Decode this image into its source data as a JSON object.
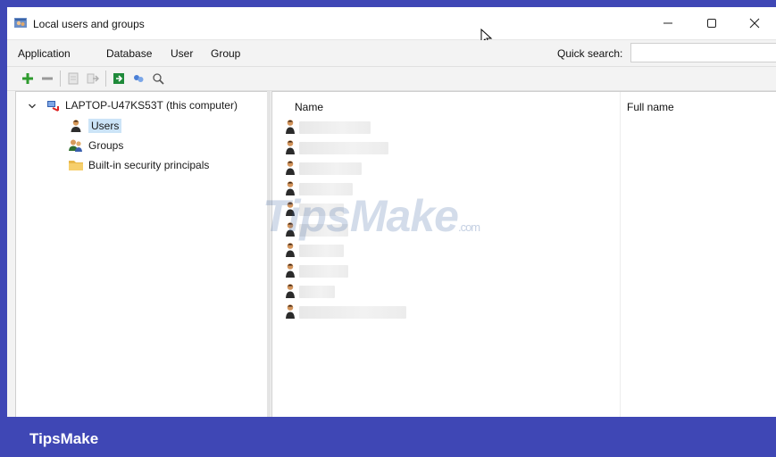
{
  "window": {
    "title": "Local users and groups",
    "icon": "users-groups-app-icon"
  },
  "menu": [
    "Application",
    "Database",
    "User",
    "Group"
  ],
  "quick_search": {
    "label": "Quick search:",
    "value": "",
    "placeholder": ""
  },
  "toolbar": [
    "add-icon",
    "remove-icon",
    "properties-icon",
    "move-icon",
    "export-icon",
    "refresh-icon",
    "search-icon"
  ],
  "tree": {
    "root": "LAPTOP-U47KS53T (this computer)",
    "children": [
      {
        "label": "Users",
        "icon": "user-icon",
        "selected": true
      },
      {
        "label": "Groups",
        "icon": "group-icon",
        "selected": false
      },
      {
        "label": "Built-in security principals",
        "icon": "folder-icon",
        "selected": false
      }
    ]
  },
  "list": {
    "columns": [
      "Name",
      "Full name"
    ],
    "row_count": 10
  },
  "watermark": {
    "main": "TipsMake",
    "suffix": ".com"
  },
  "footer": {
    "brand": "TipsMake"
  },
  "colors": {
    "frame": "#3f47b5",
    "selection": "#cce4f7",
    "add": "#2e9b2e"
  }
}
